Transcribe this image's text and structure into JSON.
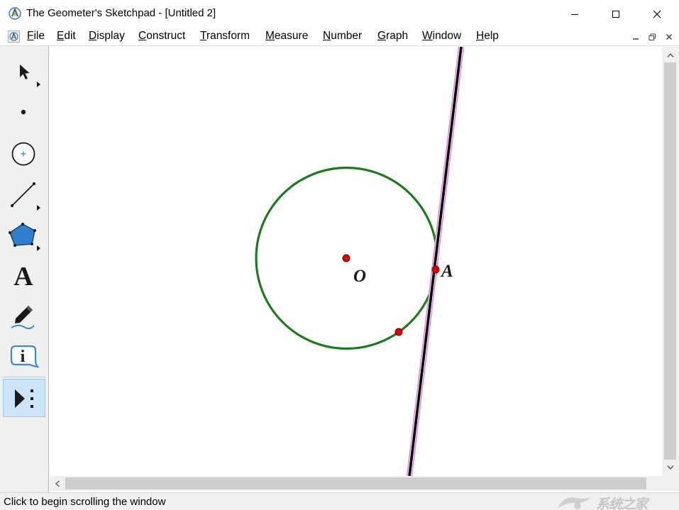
{
  "window": {
    "title": "The Geometer's Sketchpad - [Untitled 2]",
    "controls": [
      "minimize",
      "maximize",
      "close"
    ]
  },
  "menu": [
    {
      "mnemonic": "F",
      "rest": "ile"
    },
    {
      "mnemonic": "E",
      "rest": "dit"
    },
    {
      "mnemonic": "D",
      "rest": "isplay"
    },
    {
      "mnemonic": "C",
      "rest": "onstruct"
    },
    {
      "mnemonic": "T",
      "rest": "ransform"
    },
    {
      "mnemonic": "M",
      "rest": "easure"
    },
    {
      "mnemonic": "N",
      "rest": "umber"
    },
    {
      "mnemonic": "G",
      "rest": "raph"
    },
    {
      "mnemonic": "W",
      "rest": "indow"
    },
    {
      "mnemonic": "H",
      "rest": "elp"
    }
  ],
  "toolbox": {
    "tools": [
      {
        "name": "arrow-tool",
        "icon": "arrow-select-icon"
      },
      {
        "name": "point-tool",
        "icon": "point-icon"
      },
      {
        "name": "compass-tool",
        "icon": "circle-icon"
      },
      {
        "name": "straightedge-tool",
        "icon": "segment-icon"
      },
      {
        "name": "polygon-tool",
        "icon": "polygon-icon"
      },
      {
        "name": "text-tool",
        "icon": "text-icon",
        "label": "A"
      },
      {
        "name": "marker-tool",
        "icon": "marker-pen-icon"
      },
      {
        "name": "information-tool",
        "icon": "info-icon",
        "label": "i"
      },
      {
        "name": "custom-tool",
        "icon": "custom-tool-icon",
        "active": true
      }
    ]
  },
  "sketch": {
    "labels": {
      "center": "O",
      "tangent_point": "A"
    },
    "colors": {
      "circle": "#1a7d1a",
      "point": "#e00000",
      "line": "#000000",
      "line_highlight": "#e070e0"
    }
  },
  "status": {
    "text": "Click to begin scrolling the window"
  },
  "watermark": {
    "text": "系统之家"
  },
  "colors": {
    "chrome": "#f0f0f0",
    "active_tool": "#cce4f7",
    "scroll_thumb": "#cdcdcd"
  }
}
